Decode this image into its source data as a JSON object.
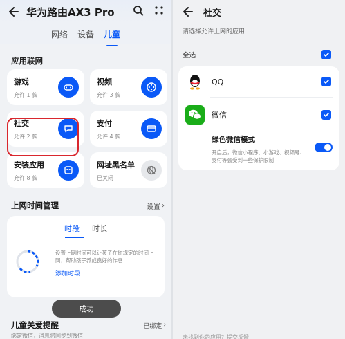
{
  "left": {
    "title": "华为路由AX3 Pro",
    "tabs": [
      "网络",
      "设备",
      "儿童"
    ],
    "active_tab": 2,
    "section_apps": "应用联网",
    "cards": [
      {
        "title": "游戏",
        "sub": "允许 1 款",
        "icon": "gamepad-icon"
      },
      {
        "title": "视频",
        "sub": "允许 3 款",
        "icon": "video-reel-icon"
      },
      {
        "title": "社交",
        "sub": "允许 2 款",
        "icon": "chat-bubble-icon"
      },
      {
        "title": "支付",
        "sub": "允许 4 款",
        "icon": "card-icon"
      },
      {
        "title": "安装应用",
        "sub": "允许 8 款",
        "icon": "bag-icon"
      },
      {
        "title": "网址黑名单",
        "sub": "已关闭",
        "icon": "globe-blocked-icon"
      }
    ],
    "time_section": "上网时间管理",
    "time_settings": "设置",
    "time_tabs": [
      "时段",
      "时长"
    ],
    "time_desc": "设置上网时间可以让孩子在你规定的时间上网，帮助孩子养成良好的作息",
    "time_link": "添加时段",
    "toast": "成功",
    "care_title": "儿童关爱提醒",
    "care_status": "已绑定",
    "care_desc": "绑定微信，消息将同步到微信"
  },
  "right": {
    "title": "社交",
    "hint": "请选择允许上网的应用",
    "select_all": "全选",
    "apps": [
      {
        "name": "QQ",
        "checked": true
      },
      {
        "name": "微信",
        "checked": true
      }
    ],
    "mode_title": "绿色微信模式",
    "mode_desc": "开启后，微信小程序、小游戏、视频号、支付等会受到一些保护限制",
    "mode_on": true,
    "footer": "未找到你的应用？提交反馈"
  },
  "colors": {
    "accent": "#0a59f7",
    "highlight": "#d9272e",
    "wechat": "#1aad19"
  }
}
